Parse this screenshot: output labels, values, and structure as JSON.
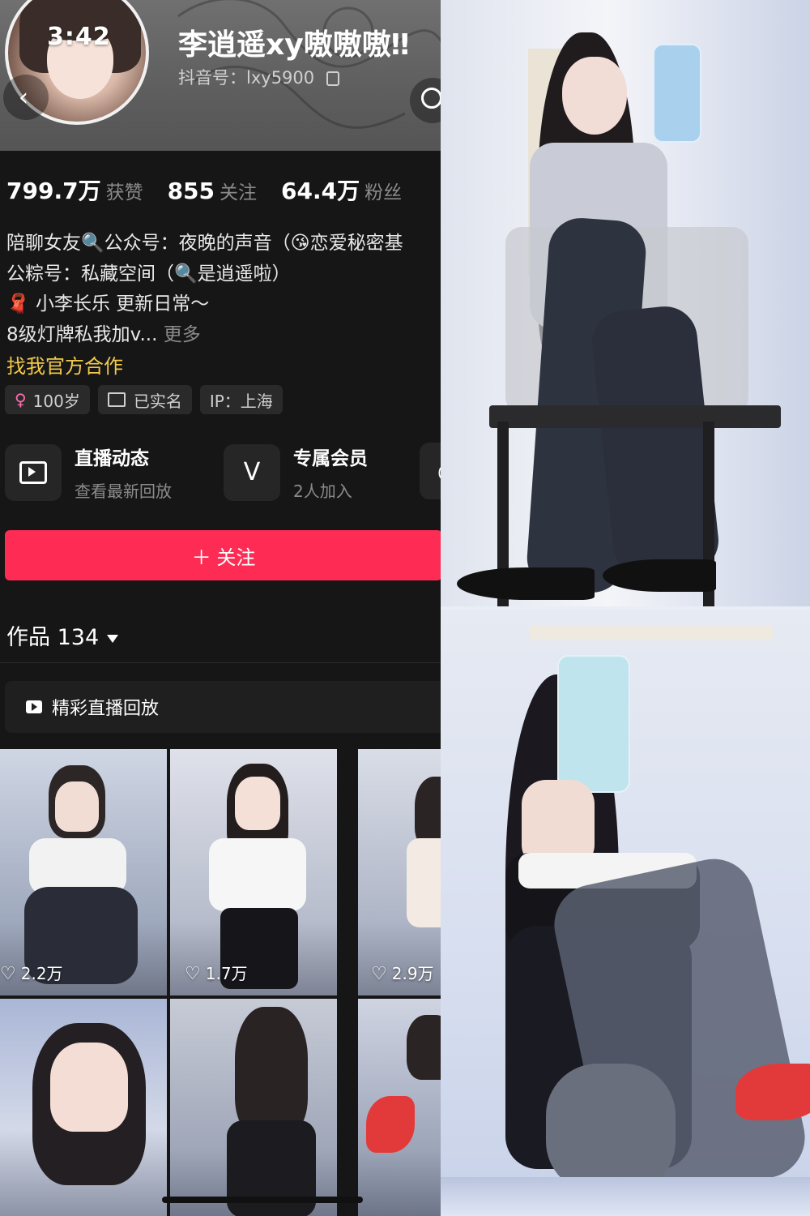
{
  "status": {
    "time": "3:42"
  },
  "profile": {
    "name": "李逍遥xy嗷嗷嗷‼",
    "handle": "抖音号：lxy5900"
  },
  "stats": [
    {
      "value": "799.7万",
      "label": "获赞"
    },
    {
      "value": "855",
      "label": "关注"
    },
    {
      "value": "64.4万",
      "label": "粉丝"
    }
  ],
  "bio": {
    "line1": "陪聊女友🔍公众号：夜晚的声音（😘恋爱秘密基",
    "line2": "公粽号：私藏空间（🔍是逍遥啦）",
    "line3": "🧣 小李长乐  更新日常～",
    "line4": "8级灯牌私我加v...",
    "more": "更多",
    "cooperation": "找我官方合作"
  },
  "tags": {
    "age": "100岁",
    "verified": "已实名",
    "ip": "IP：上海"
  },
  "features": [
    {
      "title": "直播动态",
      "subtitle": "查看最新回放"
    },
    {
      "title": "专属会员",
      "subtitle": "2人加入"
    }
  ],
  "follow_label": "＋ 关注",
  "works": {
    "label": "作品 134"
  },
  "replay_label": "精彩直播回放",
  "videos": [
    {
      "likes": "2.2万"
    },
    {
      "likes": "1.7万"
    },
    {
      "likes": "2.9万"
    }
  ],
  "colors": {
    "accent": "#fe2c55",
    "link": "#f2c94c",
    "background": "#161616"
  }
}
